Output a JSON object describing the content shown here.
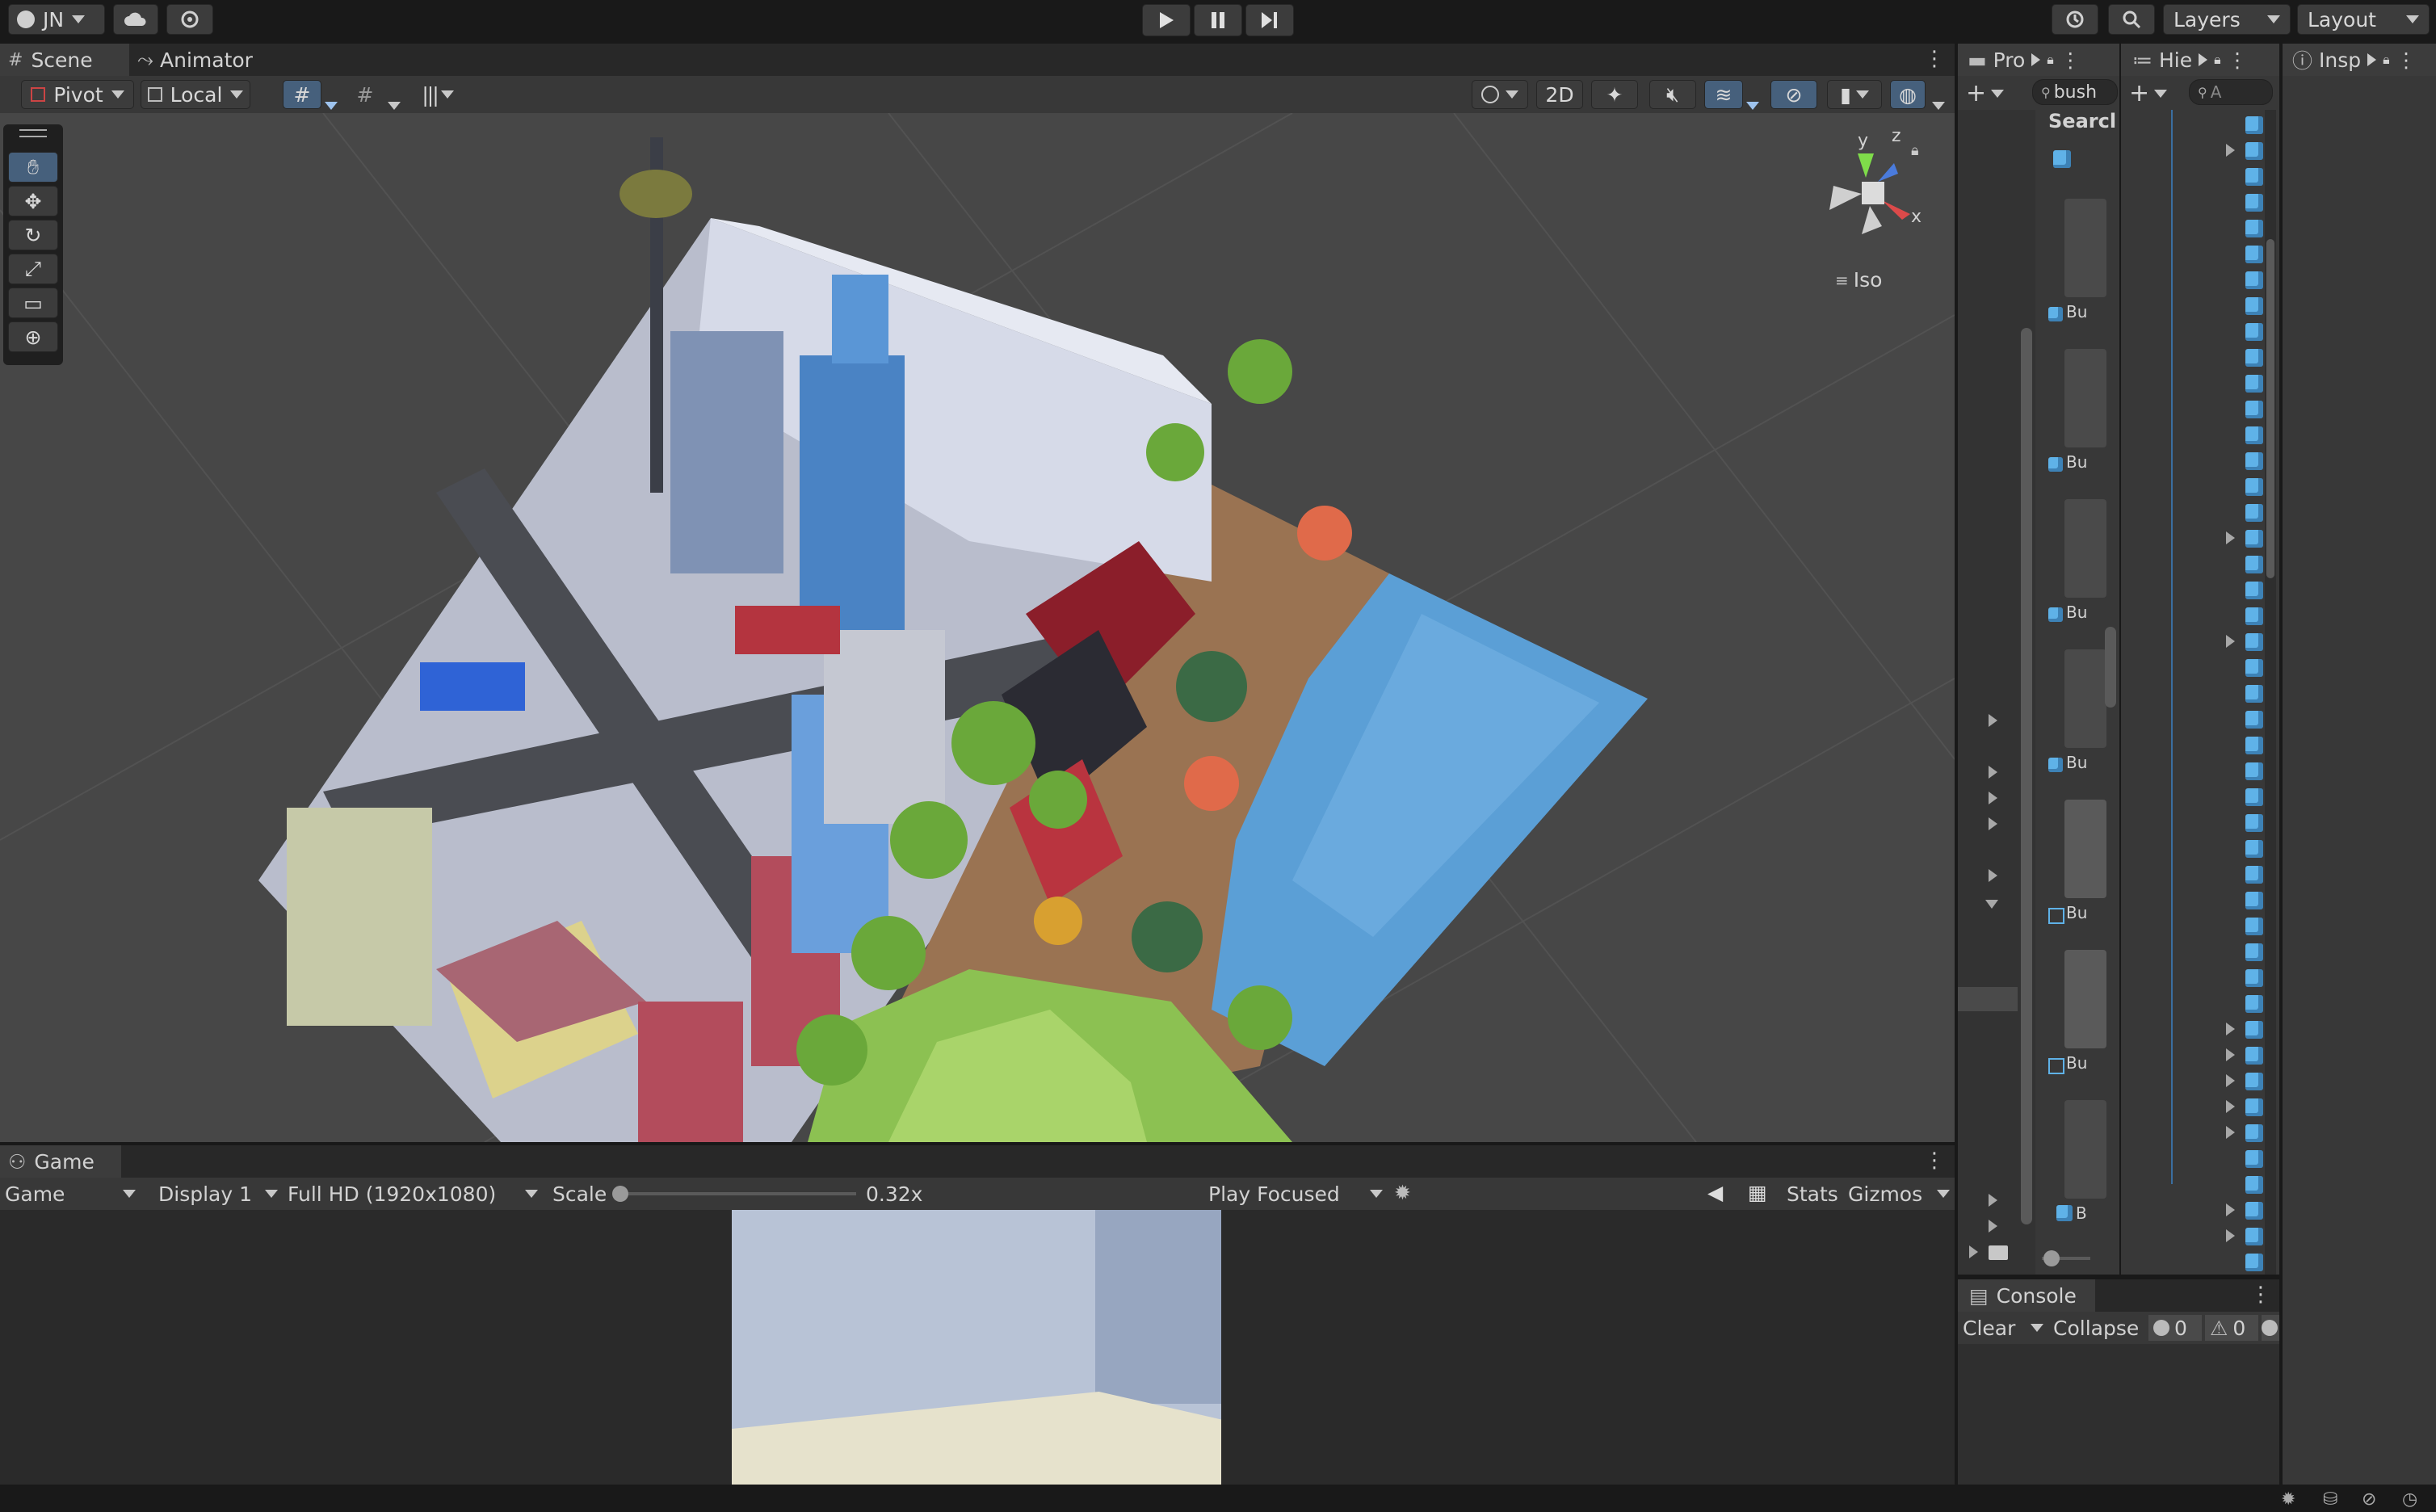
{
  "toolbar": {
    "account_label": "JN",
    "layers_label": "Layers",
    "layout_label": "Layout"
  },
  "scene": {
    "tab_scene": "Scene",
    "tab_animator": "Animator",
    "pivot_label": "Pivot",
    "local_label": "Local",
    "mode_2d": "2D",
    "gizmo_y": "y",
    "gizmo_z": "z",
    "gizmo_x": "x",
    "projection_label": "Iso"
  },
  "game": {
    "tab_label": "Game",
    "view_select": "Game",
    "display_select": "Display 1",
    "resolution_select": "Full HD (1920x1080)",
    "scale_label": "Scale",
    "scale_value": "0.32x",
    "scale_fraction": 0.0,
    "play_mode_select": "Play Focused",
    "stats_label": "Stats",
    "gizmos_label": "Gizmos"
  },
  "project": {
    "tab_label": "Pro",
    "search_value": "bush",
    "search_header": "Searcl",
    "items": [
      {
        "label": "Bu"
      },
      {
        "label": "Bu"
      },
      {
        "label": "Bu"
      },
      {
        "label": "Bu"
      },
      {
        "label": "Bu"
      },
      {
        "label": "Bu"
      },
      {
        "label": "B"
      }
    ]
  },
  "hierarchy": {
    "tab_label": "Hie",
    "search_placeholder": "A"
  },
  "inspector": {
    "tab_label": "Insp"
  },
  "console": {
    "tab_label": "Console",
    "clear_label": "Clear",
    "collapse_label": "Collapse",
    "error_count": "0",
    "warning_count": "0"
  },
  "colors": {
    "accent": "#46607c",
    "cube_icon": "#5fb2e8",
    "water": "#5b9fd6",
    "sand": "#9a7352",
    "grass": "#8cc152"
  }
}
